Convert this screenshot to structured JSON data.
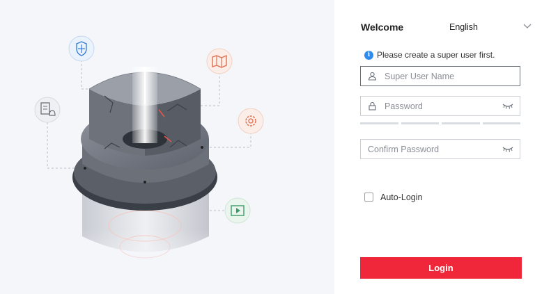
{
  "header": {
    "welcome": "Welcome",
    "language": "English"
  },
  "notice": {
    "text": "Please create a super user first."
  },
  "form": {
    "username_placeholder": "Super User Name",
    "password_placeholder": "Password",
    "confirm_placeholder": "Confirm Password",
    "auto_login_label": "Auto-Login",
    "auto_login_checked": false,
    "login_label": "Login"
  },
  "colors": {
    "accent": "#f0263a",
    "info": "#2d8cf0"
  },
  "illustration": {
    "icons": [
      "shield-icon",
      "map-icon",
      "document-bell-icon",
      "gear-icon",
      "video-icon"
    ]
  }
}
